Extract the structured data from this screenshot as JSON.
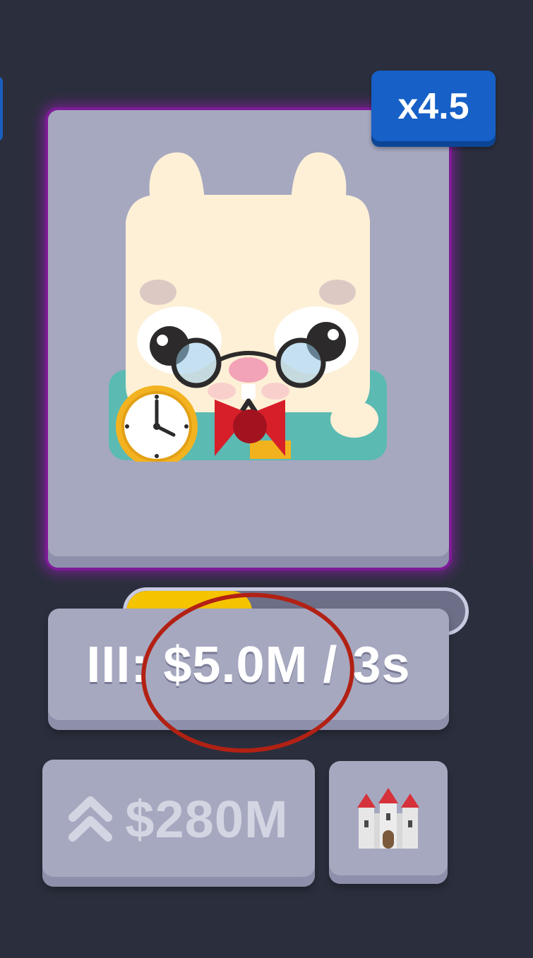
{
  "card": {
    "multiplier": "x4.5",
    "progress_fraction": 0.37,
    "character_icon": "bunny-with-glasses-pocket-watch-bowtie"
  },
  "rate_button": {
    "label": "III: $5.0M / 3s"
  },
  "upgrade_button": {
    "icon": "double-chevron-up-icon",
    "price": "$280M"
  },
  "castle_button": {
    "icon": "castle-icon"
  },
  "colors": {
    "background": "#2b2f3d",
    "card": "#a6a8c0",
    "glow": "#7d1b97",
    "multiplier_badge": "#1660c7",
    "progress_fill": "#f5c400",
    "highlight_ring": "#b22114"
  }
}
